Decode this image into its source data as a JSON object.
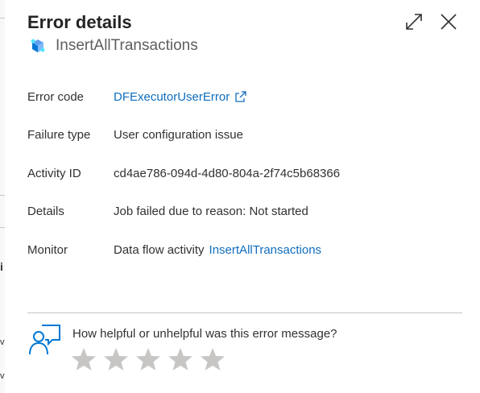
{
  "dialog": {
    "title": "Error details",
    "subtitle": "InsertAllTransactions",
    "subtitle_icon": "data-flow-activity-icon",
    "expand_icon": "expand-icon",
    "close_icon": "close-icon"
  },
  "details": {
    "error_code_label": "Error code",
    "error_code_value": "DFExecutorUserError",
    "failure_type_label": "Failure type",
    "failure_type_value": "User configuration issue",
    "activity_id_label": "Activity ID",
    "activity_id_value": "cd4ae786-094d-4d80-804a-2f74c5b68366",
    "details_label": "Details",
    "details_value": "Job failed due to reason: Not started",
    "monitor_label": "Monitor",
    "monitor_prefix": "Data flow activity",
    "monitor_link": "InsertAllTransactions"
  },
  "feedback": {
    "question": "How helpful or unhelpful was this error message?",
    "rating_max": 5,
    "rating_value": 0,
    "icon": "feedback-person-icon"
  },
  "colors": {
    "link": "#106ebe",
    "text": "#323130",
    "muted": "#605e5c",
    "star": "#c8c6c4",
    "icon_blue": "#0078d4"
  },
  "background_page": {
    "edge_glyphs": [
      "i",
      "v",
      "v"
    ]
  }
}
